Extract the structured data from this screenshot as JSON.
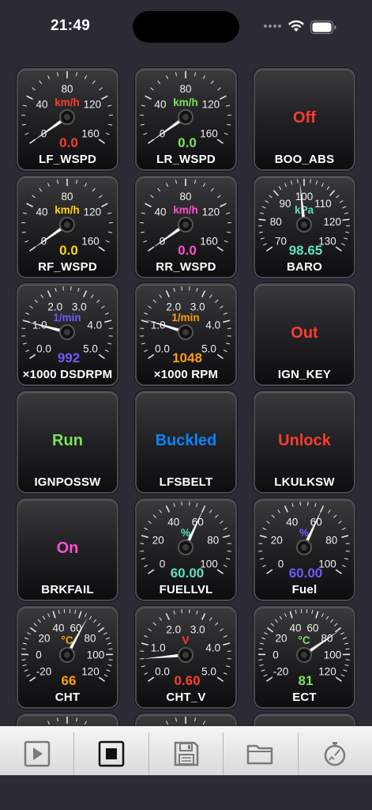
{
  "status_bar": {
    "time": "21:49"
  },
  "colors": {
    "red": "#ff3b30",
    "green": "#7ae35a",
    "yellow": "#ffd60a",
    "magenta": "#ff4fd1",
    "teal": "#5ee0c0",
    "indigo": "#6d5cff",
    "orange": "#ff9f0a",
    "blue": "#0a84ff"
  },
  "tiles": [
    {
      "kind": "gauge",
      "label": "LF_WSPD",
      "unit": "km/h",
      "value": "0.0",
      "value_num": 0,
      "unit_color": "#ff3b30",
      "value_color": "#ff3b30",
      "range": [
        0,
        160
      ],
      "ticks": [
        "0",
        "40",
        "80",
        "120",
        "160"
      ]
    },
    {
      "kind": "gauge",
      "label": "LR_WSPD",
      "unit": "km/h",
      "value": "0.0",
      "value_num": 0,
      "unit_color": "#7ae35a",
      "value_color": "#7ae35a",
      "range": [
        0,
        160
      ],
      "ticks": [
        "0",
        "40",
        "80",
        "120",
        "160"
      ]
    },
    {
      "kind": "switch",
      "label": "BOO_ABS",
      "value": "Off",
      "value_color": "#ff3b30"
    },
    {
      "kind": "gauge",
      "label": "RF_WSPD",
      "unit": "km/h",
      "value": "0.0",
      "value_num": 0,
      "unit_color": "#ffd60a",
      "value_color": "#ffd60a",
      "range": [
        0,
        160
      ],
      "ticks": [
        "0",
        "40",
        "80",
        "120",
        "160"
      ]
    },
    {
      "kind": "gauge",
      "label": "RR_WSPD",
      "unit": "km/h",
      "value": "0.0",
      "value_num": 0,
      "unit_color": "#ff4fd1",
      "value_color": "#ff4fd1",
      "range": [
        0,
        160
      ],
      "ticks": [
        "0",
        "40",
        "80",
        "120",
        "160"
      ]
    },
    {
      "kind": "gauge",
      "label": "BARO",
      "unit": "kPa",
      "value": "98.65",
      "value_num": 98.65,
      "unit_color": "#5ee0c0",
      "value_color": "#5ee0c0",
      "range": [
        70,
        130
      ],
      "ticks": [
        "70",
        "80",
        "90",
        "100",
        "110",
        "120",
        "130"
      ]
    },
    {
      "kind": "gauge",
      "label": "×1000 DSDRPM",
      "unit": "1/min",
      "value": "992",
      "value_num": 0.992,
      "unit_color": "#6d5cff",
      "value_color": "#6d5cff",
      "range": [
        0,
        5
      ],
      "ticks": [
        "0.0",
        "1.0",
        "2.0",
        "3.0",
        "4.0",
        "5.0"
      ]
    },
    {
      "kind": "gauge",
      "label": "×1000 RPM",
      "unit": "1/min",
      "value": "1048",
      "value_num": 1.048,
      "unit_color": "#ff9f0a",
      "value_color": "#ff9f0a",
      "range": [
        0,
        5
      ],
      "ticks": [
        "0.0",
        "1.0",
        "2.0",
        "3.0",
        "4.0",
        "5.0"
      ]
    },
    {
      "kind": "switch",
      "label": "IGN_KEY",
      "value": "Out",
      "value_color": "#ff3b30"
    },
    {
      "kind": "switch",
      "label": "IGNPOSSW",
      "value": "Run",
      "value_color": "#7ae35a"
    },
    {
      "kind": "switch",
      "label": "LFSBELT",
      "value": "Buckled",
      "value_color": "#0a84ff"
    },
    {
      "kind": "switch",
      "label": "LKULKSW",
      "value": "Unlock",
      "value_color": "#ff3b30"
    },
    {
      "kind": "switch",
      "label": "BRKFAIL",
      "value": "On",
      "value_color": "#ff4fd1"
    },
    {
      "kind": "gauge",
      "label": "FUELLVL",
      "unit": "%",
      "value": "60.00",
      "value_num": 60,
      "unit_color": "#5ee0c0",
      "value_color": "#5ee0c0",
      "range": [
        0,
        100
      ],
      "ticks": [
        "0",
        "20",
        "40",
        "60",
        "80",
        "100"
      ]
    },
    {
      "kind": "gauge",
      "label": "Fuel",
      "unit": "%",
      "value": "60.00",
      "value_num": 60,
      "unit_color": "#6d5cff",
      "value_color": "#6d5cff",
      "range": [
        0,
        100
      ],
      "ticks": [
        "0",
        "20",
        "40",
        "60",
        "80",
        "100"
      ]
    },
    {
      "kind": "gauge",
      "label": "CHT",
      "unit": "°C",
      "value": "66",
      "value_num": 66,
      "unit_color": "#ff9f0a",
      "value_color": "#ff9f0a",
      "range": [
        -20,
        120
      ],
      "ticks": [
        "-20",
        "0",
        "20",
        "40",
        "60",
        "80",
        "100",
        "120"
      ]
    },
    {
      "kind": "gauge",
      "label": "CHT_V",
      "unit": "V",
      "value": "0.60",
      "value_num": 0.6,
      "unit_color": "#ff3b30",
      "value_color": "#ff3b30",
      "range": [
        0,
        5
      ],
      "ticks": [
        "0.0",
        "1.0",
        "2.0",
        "3.0",
        "4.0",
        "5.0"
      ]
    },
    {
      "kind": "gauge",
      "label": "ECT",
      "unit": "°C",
      "value": "81",
      "value_num": 81,
      "unit_color": "#7ae35a",
      "value_color": "#7ae35a",
      "range": [
        -20,
        120
      ],
      "ticks": [
        "-20",
        "0",
        "20",
        "40",
        "60",
        "80",
        "100",
        "120"
      ]
    },
    {
      "kind": "gauge",
      "label": "",
      "unit": "",
      "value": "",
      "value_num": 0,
      "unit_color": "#ffffff",
      "value_color": "#ffffff",
      "range": [
        0,
        5
      ],
      "ticks": []
    },
    {
      "kind": "gauge",
      "label": "",
      "unit": "",
      "value": "",
      "value_num": 0,
      "unit_color": "#ffffff",
      "value_color": "#ffffff",
      "range": [
        0,
        5
      ],
      "ticks": []
    },
    {
      "kind": "switch",
      "label": "",
      "value": "",
      "value_color": "#ffffff"
    }
  ],
  "toolbar": {
    "buttons": [
      {
        "name": "play-button",
        "icon": "play-icon"
      },
      {
        "name": "stop-button",
        "icon": "stop-icon"
      },
      {
        "name": "save-button",
        "icon": "save-icon"
      },
      {
        "name": "open-folder-button",
        "icon": "folder-icon"
      },
      {
        "name": "timer-button",
        "icon": "stopwatch-icon"
      }
    ]
  }
}
